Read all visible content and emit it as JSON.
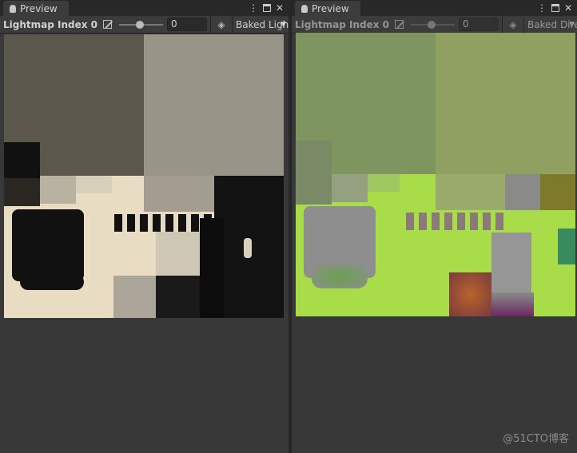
{
  "panels": [
    {
      "tab": "Preview",
      "label": "Lightmap Index 0",
      "value": "0",
      "mode": "Baked Lightn",
      "enabled": true
    },
    {
      "tab": "Preview",
      "label": "Lightmap Index 0",
      "value": "0",
      "mode": "Baked Direct",
      "enabled": false
    }
  ],
  "icons": {
    "tab": "lightbulb-icon",
    "menu": "kebab-menu-icon",
    "maximize": "maximize-icon",
    "close": "close-icon",
    "exposure": "exposure-icon",
    "layers": "layers-icon",
    "dropdown": "triangle-down-icon"
  },
  "colors": {
    "background": "#383838",
    "toolbar": "#3c3c3c",
    "tabbar": "#282828"
  },
  "watermark": "@51CTO博客"
}
